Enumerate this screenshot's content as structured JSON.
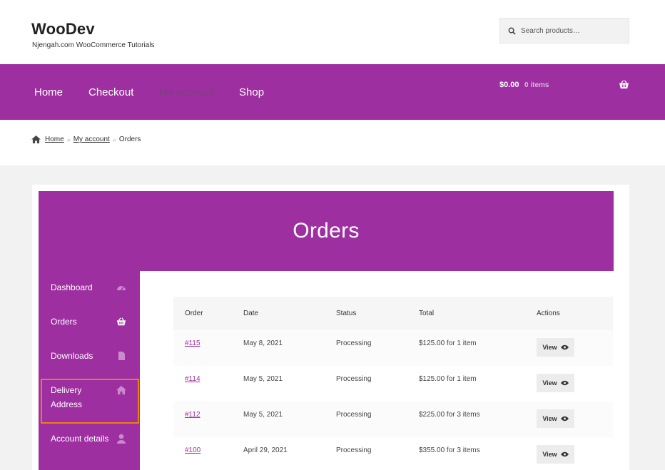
{
  "site": {
    "title": "WooDev",
    "tagline": "Njengah.com WooCommerce Tutorials"
  },
  "search": {
    "placeholder": "Search products…"
  },
  "nav": {
    "items": [
      {
        "label": "Home"
      },
      {
        "label": "Checkout"
      },
      {
        "label": "My account"
      },
      {
        "label": "Shop"
      }
    ]
  },
  "cart": {
    "total": "$0.00",
    "count": "0 items"
  },
  "breadcrumb": {
    "home": "Home",
    "account": "My account",
    "current": "Orders"
  },
  "page": {
    "title": "Orders"
  },
  "sidebar": {
    "items": [
      {
        "label": "Dashboard",
        "icon": "dashboard-icon"
      },
      {
        "label": "Orders",
        "icon": "basket-icon"
      },
      {
        "label": "Downloads",
        "icon": "file-icon"
      },
      {
        "label": "Delivery Address",
        "icon": "home-icon"
      },
      {
        "label": "Account details",
        "icon": "user-icon"
      }
    ]
  },
  "table": {
    "headers": [
      "Order",
      "Date",
      "Status",
      "Total",
      "Actions"
    ],
    "rows": [
      {
        "order": "#115",
        "date": "May 8, 2021",
        "status": "Processing",
        "total": "$125.00 for 1 item",
        "action": "View"
      },
      {
        "order": "#114",
        "date": "May 5, 2021",
        "status": "Processing",
        "total": "$125.00 for 1 item",
        "action": "View"
      },
      {
        "order": "#112",
        "date": "May 5, 2021",
        "status": "Processing",
        "total": "$225.00 for 3 items",
        "action": "View"
      },
      {
        "order": "#100",
        "date": "April 29, 2021",
        "status": "Processing",
        "total": "$355.00 for 3 items",
        "action": "View"
      }
    ]
  },
  "colors": {
    "brand": "#9e2fa1",
    "highlight": "#f07d12"
  }
}
